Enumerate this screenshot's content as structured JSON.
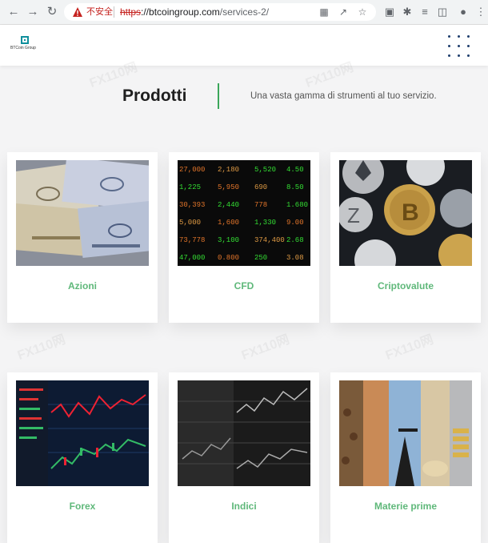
{
  "browser": {
    "security_label": "不安全",
    "url_scheme": "https",
    "url_host": "://btcoingroup.com",
    "url_path": "/services-2/"
  },
  "site": {
    "logo_text": "BTCoin Group"
  },
  "section": {
    "title": "Prodotti",
    "subtitle": "Una vasta gamma di strumenti al tuo servizio."
  },
  "products": [
    {
      "label": "Azioni"
    },
    {
      "label": "CFD"
    },
    {
      "label": "Criptovalute"
    },
    {
      "label": "Forex"
    },
    {
      "label": "Indici"
    },
    {
      "label": "Materie prime"
    }
  ],
  "watermark": "FX110网",
  "colors": {
    "accent": "#5fb87a",
    "divider": "#3aa65a",
    "logo": "#0f8f9c",
    "menu_dots": "#1f3f6e",
    "insecure": "#c5221f"
  }
}
